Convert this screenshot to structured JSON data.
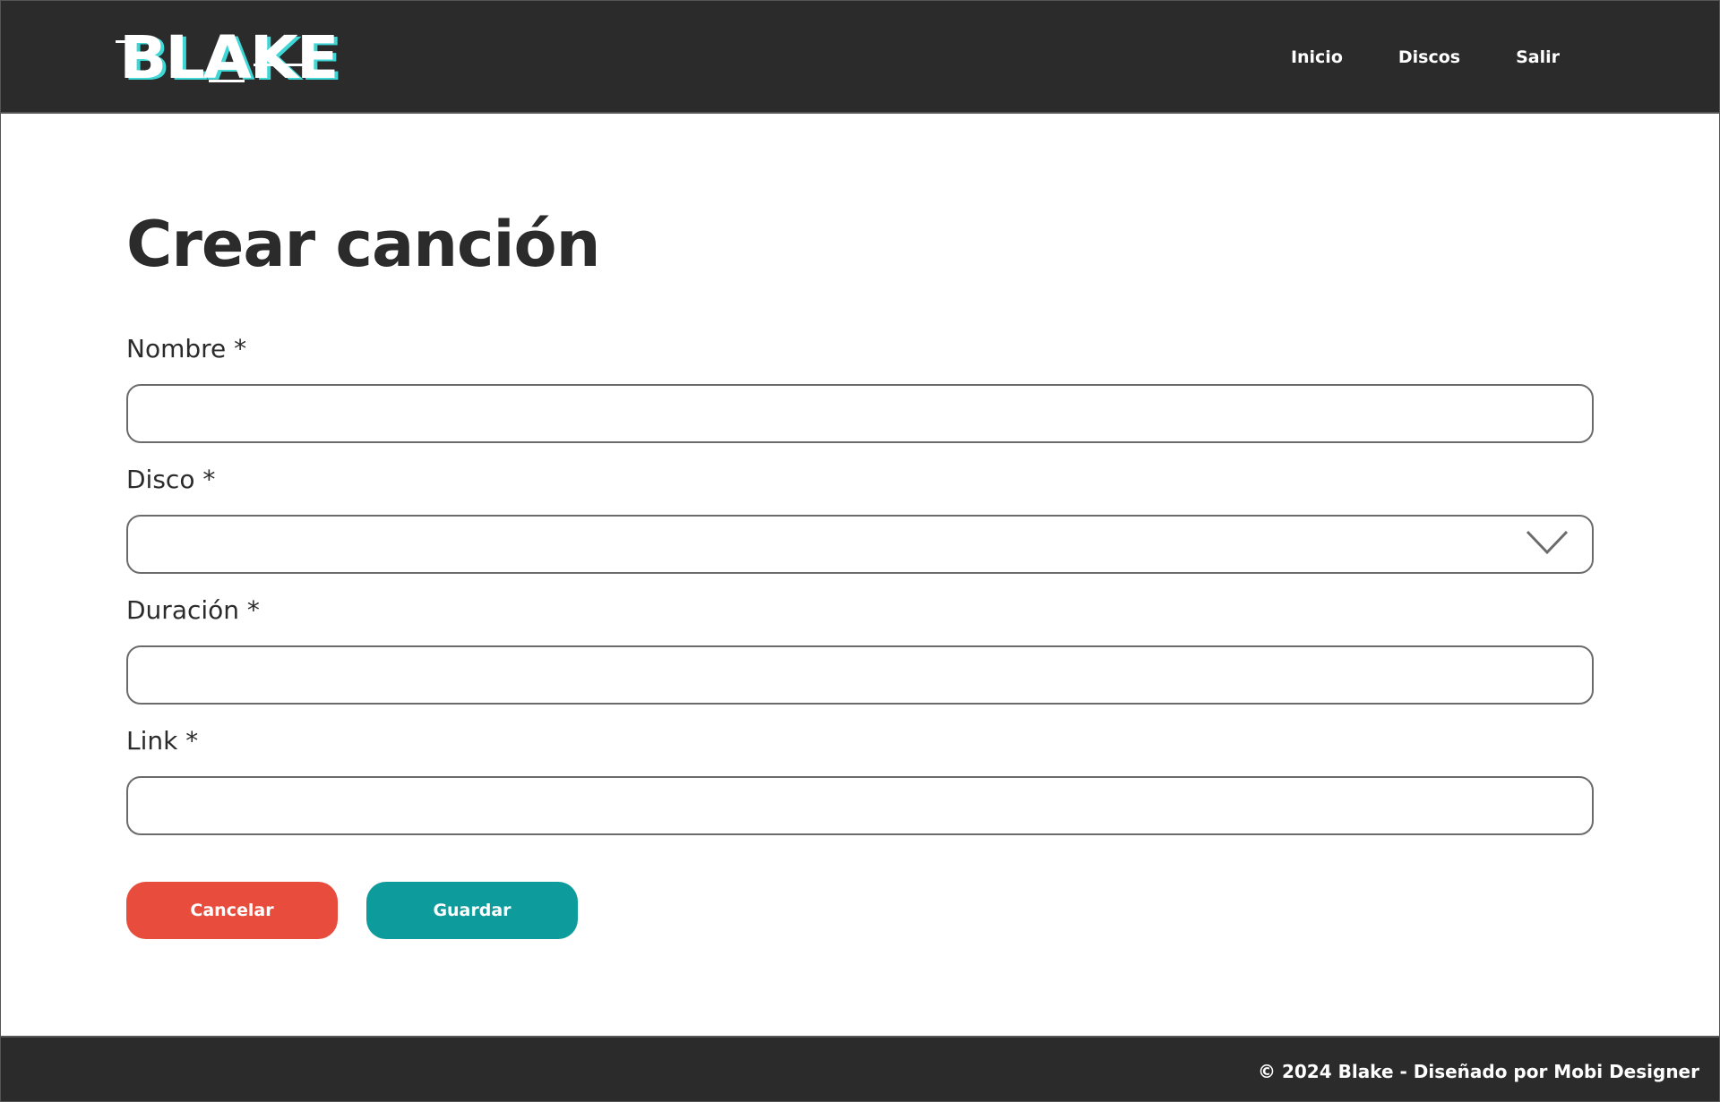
{
  "header": {
    "logo_text": "BLAKE",
    "nav": [
      {
        "label": "Inicio"
      },
      {
        "label": "Discos"
      },
      {
        "label": "Salir"
      }
    ]
  },
  "main": {
    "title": "Crear canción",
    "fields": {
      "nombre": {
        "label": "Nombre *",
        "value": ""
      },
      "disco": {
        "label": "Disco *",
        "value": ""
      },
      "duracion": {
        "label": "Duración *",
        "value": ""
      },
      "link": {
        "label": "Link *",
        "value": ""
      }
    },
    "buttons": {
      "cancel_label": "Cancelar",
      "save_label": "Guardar"
    }
  },
  "footer": {
    "text": "© 2024 Blake - Diseñado por Mobi Designer"
  },
  "colors": {
    "header_bg": "#2b2b2b",
    "cancel": "#e84c3d",
    "save": "#0e9b9b",
    "logo_accent": "#3fd7d6"
  },
  "icons": {
    "select_arrow": "chevron-down-icon"
  }
}
